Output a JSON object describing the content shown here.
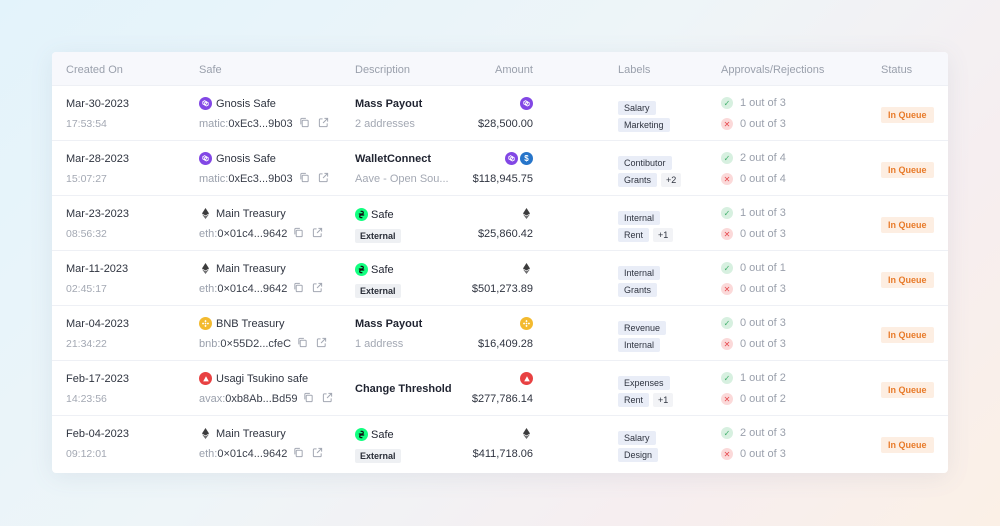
{
  "headers": {
    "created_on": "Created On",
    "safe": "Safe",
    "description": "Description",
    "amount": "Amount",
    "labels": "Labels",
    "approvals": "Approvals/Rejections",
    "status": "Status"
  },
  "rows": [
    {
      "date": "Mar-30-2023",
      "time": "17:53:54",
      "safe_name": "Gnosis Safe",
      "safe_icon": "polygon-icon",
      "addr_prefix": "matic:",
      "addr": "0xEc3...9b03",
      "desc_type": "text",
      "desc_title": "Mass Payout",
      "desc_sub": "2 addresses",
      "tokens": [
        "polygon-icon"
      ],
      "amount": "$28,500.00",
      "label1": "Salary",
      "label2": "Marketing",
      "label_more": "",
      "approvals": "1 out of 3",
      "rejections": "0 out of 3",
      "status": "In Queue"
    },
    {
      "date": "Mar-28-2023",
      "time": "15:07:27",
      "safe_name": "Gnosis Safe",
      "safe_icon": "polygon-icon",
      "addr_prefix": "matic:",
      "addr": "0xEc3...9b03",
      "desc_type": "text",
      "desc_title": "WalletConnect",
      "desc_sub": "Aave - Open Sou...",
      "tokens": [
        "polygon-icon",
        "usdc-icon"
      ],
      "amount": "$118,945.75",
      "label1": "Contibutor",
      "label2": "Grants",
      "label_more": "+2",
      "approvals": "2 out of 4",
      "rejections": "0 out of 4",
      "status": "In Queue"
    },
    {
      "date": "Mar-23-2023",
      "time": "08:56:32",
      "safe_name": "Main Treasury",
      "safe_icon": "ethereum-icon",
      "addr_prefix": "eth:",
      "addr": "0×01c4...9642",
      "desc_type": "safe",
      "desc_title": "Safe",
      "desc_sub": "External",
      "tokens": [
        "ethereum-icon"
      ],
      "amount": "$25,860.42",
      "label1": "Internal",
      "label2": "Rent",
      "label_more": "+1",
      "approvals": "1 out of 3",
      "rejections": "0 out of 3",
      "status": "In Queue"
    },
    {
      "date": "Mar-11-2023",
      "time": "02:45:17",
      "safe_name": "Main Treasury",
      "safe_icon": "ethereum-icon",
      "addr_prefix": "eth:",
      "addr": "0×01c4...9642",
      "desc_type": "safe",
      "desc_title": "Safe",
      "desc_sub": "External",
      "tokens": [
        "ethereum-icon"
      ],
      "amount": "$501,273.89",
      "label1": "Internal",
      "label2": "Grants",
      "label_more": "",
      "approvals": "0 out of 1",
      "rejections": "0 out of 3",
      "status": "In Queue"
    },
    {
      "date": "Mar-04-2023",
      "time": "21:34:22",
      "safe_name": "BNB Treasury",
      "safe_icon": "bnb-icon",
      "addr_prefix": "bnb:",
      "addr": "0×55D2...cfeC",
      "desc_type": "text",
      "desc_title": "Mass Payout",
      "desc_sub": "1 address",
      "tokens": [
        "bnb-icon"
      ],
      "amount": "$16,409.28",
      "label1": "Revenue",
      "label2": "Internal",
      "label_more": "",
      "approvals": "0 out of 3",
      "rejections": "0 out of 3",
      "status": "In Queue"
    },
    {
      "date": "Feb-17-2023",
      "time": "14:23:56",
      "safe_name": "Usagi Tsukino safe",
      "safe_icon": "avalanche-icon",
      "addr_prefix": "avax:",
      "addr": "0xb8Ab...Bd59",
      "desc_type": "single",
      "desc_title": "Change Threshold",
      "desc_sub": "",
      "tokens": [
        "avalanche-icon"
      ],
      "amount": "$277,786.14",
      "label1": "Expenses",
      "label2": "Rent",
      "label_more": "+1",
      "approvals": "1 out of 2",
      "rejections": "0 out of 2",
      "status": "In Queue"
    },
    {
      "date": "Feb-04-2023",
      "time": "09:12:01",
      "safe_name": "Main Treasury",
      "safe_icon": "ethereum-icon",
      "addr_prefix": "eth:",
      "addr": "0×01c4...9642",
      "desc_type": "safe",
      "desc_title": "Safe",
      "desc_sub": "External",
      "tokens": [
        "ethereum-icon"
      ],
      "amount": "$411,718.06",
      "label1": "Salary",
      "label2": "Design",
      "label_more": "",
      "approvals": "2 out of 3",
      "rejections": "0 out of 3",
      "status": "In Queue"
    }
  ],
  "colors": {
    "polygon": "#8247e5",
    "usdc": "#2775ca",
    "bnb": "#f3ba2f",
    "avalanche": "#e84142",
    "ethereum": "#3c3c3d",
    "safe": "#12ff80",
    "status": "#e87b2a"
  }
}
